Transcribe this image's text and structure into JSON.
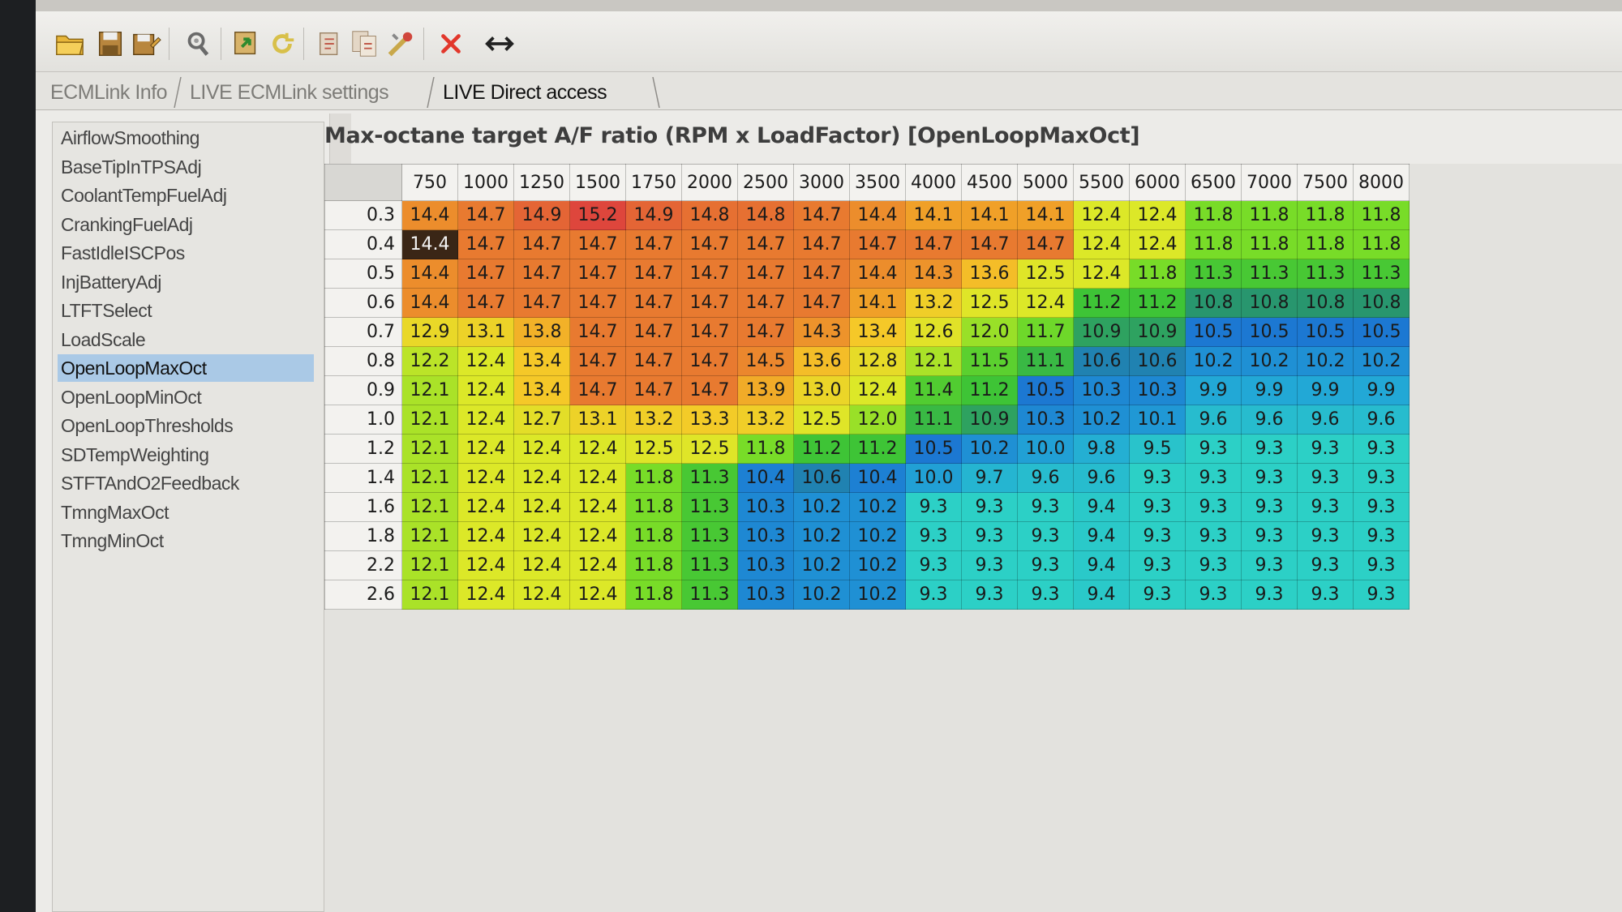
{
  "toolbar": {
    "icons": [
      "open-folder-icon",
      "save-icon",
      "save-as-icon",
      "connect-icon",
      "load-map-icon",
      "refresh-icon",
      "compare-icon",
      "copy-map-icon",
      "tools-icon",
      "close-x-icon",
      "resize-horizontal-icon"
    ]
  },
  "tabs": [
    {
      "label": "ECMLink Info",
      "active": false
    },
    {
      "label": "LIVE ECMLink settings",
      "active": false
    },
    {
      "label": "LIVE Direct access",
      "active": true
    }
  ],
  "map_list": {
    "items": [
      "AirflowSmoothing",
      "BaseTipInTPSAdj",
      "CoolantTempFuelAdj",
      "CrankingFuelAdj",
      "FastIdleISCPos",
      "InjBatteryAdj",
      "LTFTSelect",
      "LoadScale",
      "OpenLoopMaxOct",
      "OpenLoopMinOct",
      "OpenLoopThresholds",
      "SDTempWeighting",
      "STFTAndO2Feedback",
      "TmngMaxOct",
      "TmngMinOct"
    ],
    "selected": "OpenLoopMaxOct"
  },
  "map": {
    "title": "Max-octane target A/F ratio (RPM x LoadFactor) [OpenLoopMaxOct]",
    "columns": [
      "750",
      "1000",
      "1250",
      "1500",
      "1750",
      "2000",
      "2500",
      "3000",
      "3500",
      "4000",
      "4500",
      "5000",
      "5500",
      "6000",
      "6500",
      "7000",
      "7500",
      "8000"
    ],
    "rows": [
      "0.3",
      "0.4",
      "0.5",
      "0.6",
      "0.7",
      "0.8",
      "0.9",
      "1.0",
      "1.2",
      "1.4",
      "1.6",
      "1.8",
      "2.2",
      "2.6"
    ],
    "values": [
      [
        "14.4",
        "14.7",
        "14.9",
        "15.2",
        "14.9",
        "14.8",
        "14.8",
        "14.7",
        "14.4",
        "14.1",
        "14.1",
        "14.1",
        "12.4",
        "12.4",
        "11.8",
        "11.8",
        "11.8",
        "11.8"
      ],
      [
        "14.4",
        "14.7",
        "14.7",
        "14.7",
        "14.7",
        "14.7",
        "14.7",
        "14.7",
        "14.7",
        "14.7",
        "14.7",
        "14.7",
        "12.4",
        "12.4",
        "11.8",
        "11.8",
        "11.8",
        "11.8"
      ],
      [
        "14.4",
        "14.7",
        "14.7",
        "14.7",
        "14.7",
        "14.7",
        "14.7",
        "14.7",
        "14.4",
        "14.3",
        "13.6",
        "12.5",
        "12.4",
        "11.8",
        "11.3",
        "11.3",
        "11.3",
        "11.3"
      ],
      [
        "14.4",
        "14.7",
        "14.7",
        "14.7",
        "14.7",
        "14.7",
        "14.7",
        "14.7",
        "14.1",
        "13.2",
        "12.5",
        "12.4",
        "11.2",
        "11.2",
        "10.8",
        "10.8",
        "10.8",
        "10.8"
      ],
      [
        "12.9",
        "13.1",
        "13.8",
        "14.7",
        "14.7",
        "14.7",
        "14.7",
        "14.3",
        "13.4",
        "12.6",
        "12.0",
        "11.7",
        "10.9",
        "10.9",
        "10.5",
        "10.5",
        "10.5",
        "10.5"
      ],
      [
        "12.2",
        "12.4",
        "13.4",
        "14.7",
        "14.7",
        "14.7",
        "14.5",
        "13.6",
        "12.8",
        "12.1",
        "11.5",
        "11.1",
        "10.6",
        "10.6",
        "10.2",
        "10.2",
        "10.2",
        "10.2"
      ],
      [
        "12.1",
        "12.4",
        "13.4",
        "14.7",
        "14.7",
        "14.7",
        "13.9",
        "13.0",
        "12.4",
        "11.4",
        "11.2",
        "10.5",
        "10.3",
        "10.3",
        "9.9",
        "9.9",
        "9.9",
        "9.9"
      ],
      [
        "12.1",
        "12.4",
        "12.7",
        "13.1",
        "13.2",
        "13.3",
        "13.2",
        "12.5",
        "12.0",
        "11.1",
        "10.9",
        "10.3",
        "10.2",
        "10.1",
        "9.6",
        "9.6",
        "9.6",
        "9.6"
      ],
      [
        "12.1",
        "12.4",
        "12.4",
        "12.4",
        "12.5",
        "12.5",
        "11.8",
        "11.2",
        "11.2",
        "10.5",
        "10.2",
        "10.0",
        "9.8",
        "9.5",
        "9.3",
        "9.3",
        "9.3",
        "9.3"
      ],
      [
        "12.1",
        "12.4",
        "12.4",
        "12.4",
        "11.8",
        "11.3",
        "10.4",
        "10.6",
        "10.4",
        "10.0",
        "9.7",
        "9.6",
        "9.6",
        "9.3",
        "9.3",
        "9.3",
        "9.3",
        "9.3"
      ],
      [
        "12.1",
        "12.4",
        "12.4",
        "12.4",
        "11.8",
        "11.3",
        "10.3",
        "10.2",
        "10.2",
        "9.3",
        "9.3",
        "9.3",
        "9.4",
        "9.3",
        "9.3",
        "9.3",
        "9.3",
        "9.3"
      ],
      [
        "12.1",
        "12.4",
        "12.4",
        "12.4",
        "11.8",
        "11.3",
        "10.3",
        "10.2",
        "10.2",
        "9.3",
        "9.3",
        "9.3",
        "9.4",
        "9.3",
        "9.3",
        "9.3",
        "9.3",
        "9.3"
      ],
      [
        "12.1",
        "12.4",
        "12.4",
        "12.4",
        "11.8",
        "11.3",
        "10.3",
        "10.2",
        "10.2",
        "9.3",
        "9.3",
        "9.3",
        "9.4",
        "9.3",
        "9.3",
        "9.3",
        "9.3",
        "9.3"
      ],
      [
        "12.1",
        "12.4",
        "12.4",
        "12.4",
        "11.8",
        "11.3",
        "10.3",
        "10.2",
        "10.2",
        "9.3",
        "9.3",
        "9.3",
        "9.4",
        "9.3",
        "9.3",
        "9.3",
        "9.3",
        "9.3"
      ]
    ],
    "selected_cell": {
      "row": 1,
      "col": 0
    },
    "colors": {
      "highlight": "#3a2616",
      "header_bg": "#f3f2ef",
      "selection": "#aac9e6"
    }
  }
}
